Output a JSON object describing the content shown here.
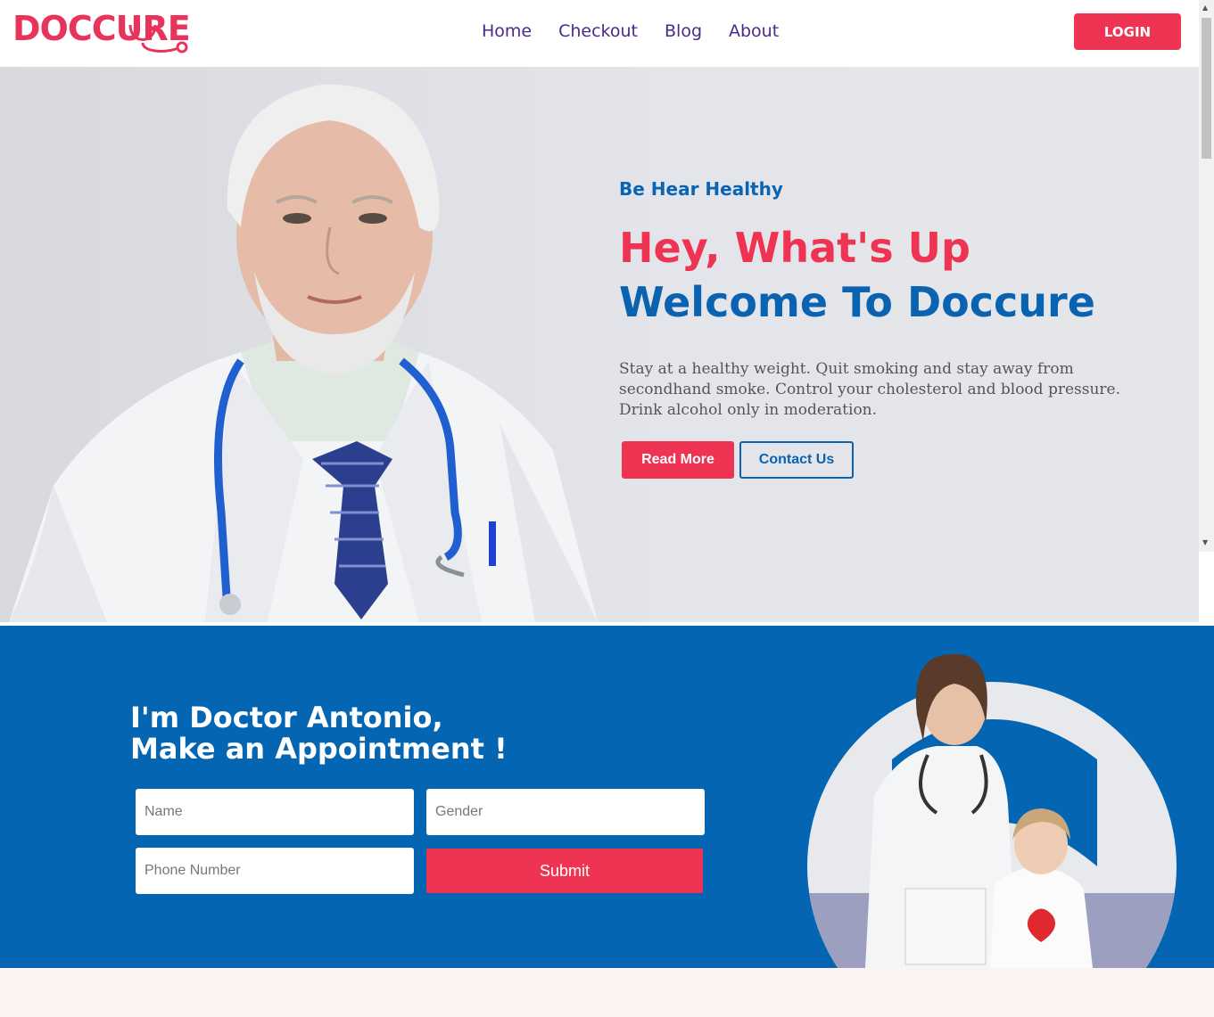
{
  "nav": {
    "logo": "DOCCURE",
    "menu": [
      "Home",
      "Checkout",
      "Blog",
      "About"
    ],
    "login": "LOGIN"
  },
  "hero": {
    "tagline": "Be Hear Healthy",
    "heading_line1": "Hey, What's Up",
    "heading_line2": "Welcome To Doccure",
    "paragraph": "Stay at a healthy weight. Quit smoking and stay away from secondhand smoke. Control your cholesterol and blood pressure. Drink alcohol only in moderation.",
    "read_more": "Read More",
    "contact_us": "Contact Us"
  },
  "appointment": {
    "title_line1": "I'm Doctor Antonio,",
    "title_line2": "Make an Appointment !",
    "name_placeholder": "Name",
    "gender_placeholder": "Gender",
    "phone_placeholder": "Phone Number",
    "submit": "Submit"
  },
  "colors": {
    "brand_red": "#ee3452",
    "brand_blue": "#0466b2",
    "nav_purple": "#4a2a8a"
  }
}
